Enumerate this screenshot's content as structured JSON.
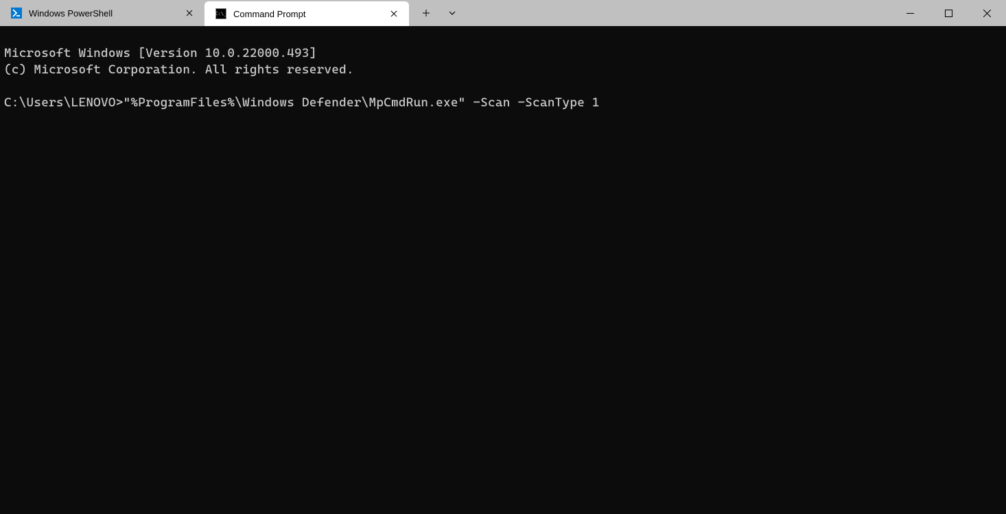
{
  "tabs": [
    {
      "title": "Windows PowerShell",
      "active": false,
      "icon": "powershell"
    },
    {
      "title": "Command Prompt",
      "active": true,
      "icon": "cmd"
    }
  ],
  "terminal": {
    "line1": "Microsoft Windows [Version 10.0.22000.493]",
    "line2": "(c) Microsoft Corporation. All rights reserved.",
    "blank": "",
    "prompt": "C:\\Users\\LENOVO>",
    "command": "\"%ProgramFiles%\\Windows Defender\\MpCmdRun.exe\" -Scan -ScanType 1"
  }
}
